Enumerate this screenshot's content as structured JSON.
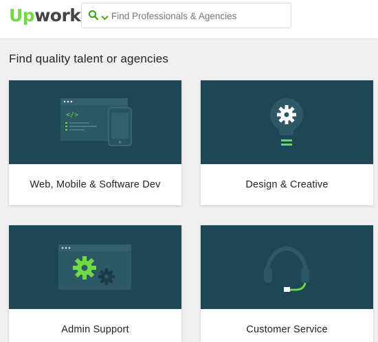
{
  "header": {
    "logo_up": "Up",
    "logo_work": "work",
    "search_placeholder": "Find Professionals & Agencies"
  },
  "main": {
    "title": "Find quality talent or agencies",
    "categories": [
      {
        "label": "Web, Mobile & Software Dev",
        "icon": "code-window-phone-icon"
      },
      {
        "label": "Design & Creative",
        "icon": "lightbulb-gear-icon"
      },
      {
        "label": "Admin Support",
        "icon": "gears-window-icon"
      },
      {
        "label": "Customer Service",
        "icon": "headset-icon"
      }
    ]
  },
  "colors": {
    "brand_green": "#6fda44",
    "card_art_bg": "#1f4654",
    "page_bg": "#f0f0f0"
  }
}
